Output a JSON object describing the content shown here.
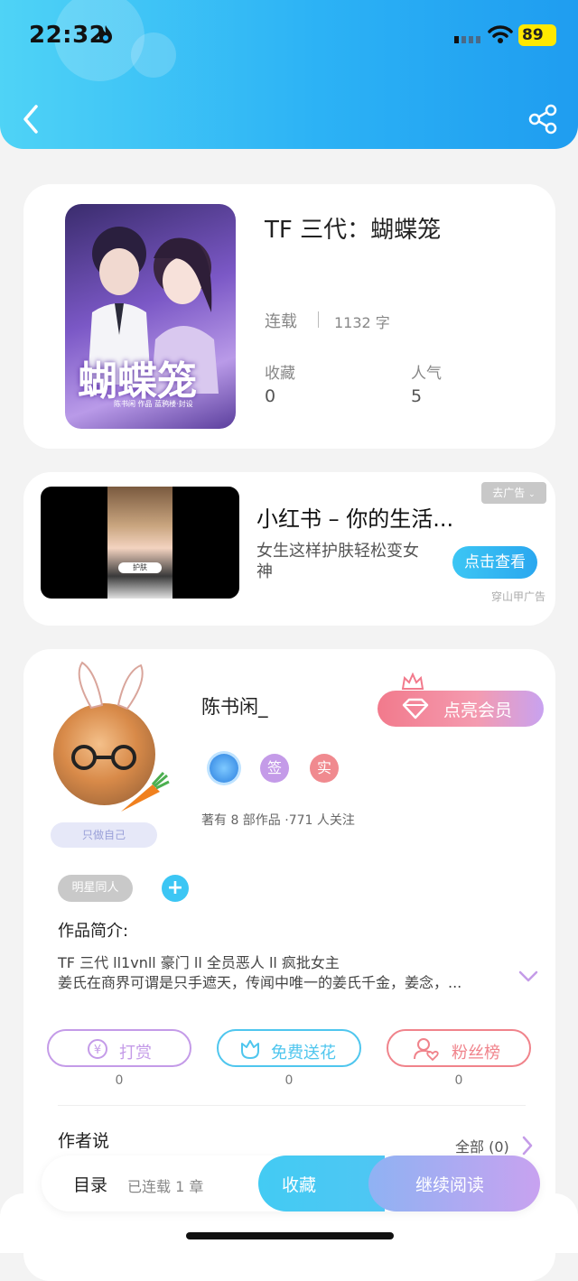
{
  "status_bar": {
    "time": "22:32",
    "battery": "89"
  },
  "book": {
    "title": "TF 三代：蝴蝶笼",
    "status": "连载",
    "word_count": "1132 字",
    "stats": [
      {
        "label": "收藏",
        "value": "0"
      },
      {
        "label": "人气",
        "value": "5"
      }
    ],
    "cover": {
      "big_title": "蝴蝶笼",
      "credit": "陈书闲 作品  蓝鸦楼·封设"
    }
  },
  "ad": {
    "title": "小红书 – 你的生活...",
    "description": "女生这样护肤轻松变女神",
    "button": "点击查看",
    "close_label": "去广告",
    "source": "穿山甲广告",
    "thumb_text": "护肤"
  },
  "author": {
    "name": "陈书闲_",
    "vip_button": "点亮会员",
    "badges": [
      {
        "label": "签",
        "color": "#c49be8"
      },
      {
        "label": "实",
        "color": "#f08a8f"
      }
    ],
    "stats_text": "著有 8 部作品 ·771 人关注",
    "avatar_tag": "只做自己",
    "tag": "明星同人",
    "add_tag": "+"
  },
  "intro": {
    "heading": "作品简介:",
    "line1": "TF 三代 ll1vnll 豪门 ll 全员恶人 ll 疯批女主",
    "line2": "姜氏在商界可谓是只手遮天，传闻中唯一的姜氏千金，姜念，..."
  },
  "actions": [
    {
      "label": "打赏",
      "count": "0",
      "color": "#c49be8"
    },
    {
      "label": "免费送花",
      "count": "0",
      "color": "#4fc6ee"
    },
    {
      "label": "粉丝榜",
      "count": "0",
      "color": "#f0838b"
    }
  ],
  "author_says": {
    "heading": "作者说",
    "all_label": "全部 (0)"
  },
  "bottom_bar": {
    "toc": "目录",
    "toc_status": "已连载 1 章",
    "favorite": "收藏",
    "continue": "继续阅读"
  }
}
